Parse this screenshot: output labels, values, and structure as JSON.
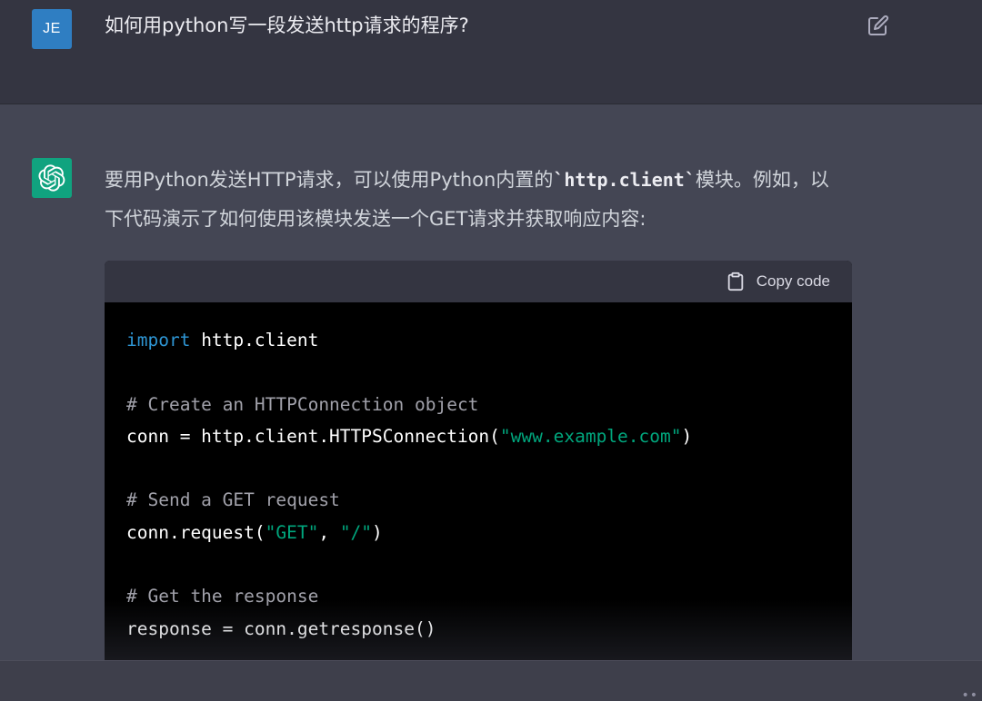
{
  "user": {
    "avatar_initials": "JE",
    "message": "如何用python写一段发送http请求的程序?"
  },
  "assistant": {
    "text_before": "要用Python发送HTTP请求，可以使用Python内置的",
    "inline_code": "`http.client`",
    "text_after": "模块。例如，以下代码演示了如何使用该模块发送一个GET请求并获取响应内容:"
  },
  "code_block": {
    "copy_label": "Copy code",
    "lines": {
      "l1_kw": "import",
      "l1_rest": " http.client",
      "l3": "# Create an HTTPConnection object",
      "l4_a": "conn = http.client.HTTPSConnection(",
      "l4_str": "\"www.example.com\"",
      "l4_b": ")",
      "l6": "# Send a GET request",
      "l7_a": "conn.request(",
      "l7_str1": "\"GET\"",
      "l7_sep": ", ",
      "l7_str2": "\"/\"",
      "l7_b": ")",
      "l9": "# Get the response",
      "l10": "response = conn.getresponse()"
    }
  },
  "colors": {
    "keyword": "#2e95d3",
    "string": "#00a67d",
    "comment": "#a1a1aa",
    "assistant_avatar": "#10a37f",
    "user_avatar": "#2f7ec2"
  },
  "icons": {
    "edit": "edit-icon",
    "copy": "clipboard-icon",
    "assistant_logo": "openai-logo-icon",
    "more": "more-dots-icon"
  }
}
